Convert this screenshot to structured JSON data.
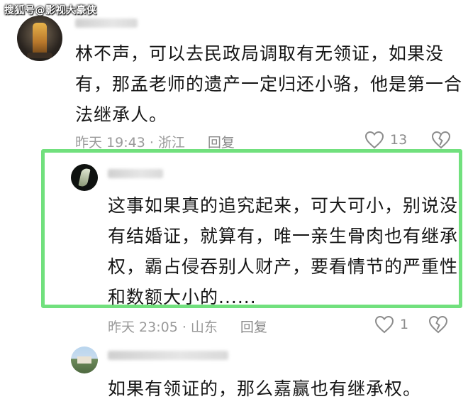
{
  "watermark": "搜狐号@影视大豪侠",
  "comments": [
    {
      "text_lines": [
        "林不声，可以去民政局调取有无领证，如果没",
        "有，那孟老师的遗产一定归还小骆，他是第一合",
        "法继承人。"
      ],
      "time": "昨天 19:43 · 浙江",
      "reply": "回复",
      "likes": "13",
      "avatar_icon": "figurine-avatar"
    },
    {
      "text_lines": [
        "这事如果真的追究起来，可大可小，别说没",
        "有结婚证，就算有，唯一亲生骨肉也有继承",
        "权，霸占侵吞别人财产，要看情节的严重性",
        "和数额大小的......"
      ],
      "time": "昨天 23:05 · 山东",
      "reply": "回复",
      "likes": "1",
      "avatar_icon": "leaf-avatar",
      "highlight_color": "#71e07d"
    },
    {
      "text_lines": [
        "如果有领证的，那么嘉赢也有继承权。"
      ],
      "avatar_icon": "landscape-avatar"
    }
  ]
}
